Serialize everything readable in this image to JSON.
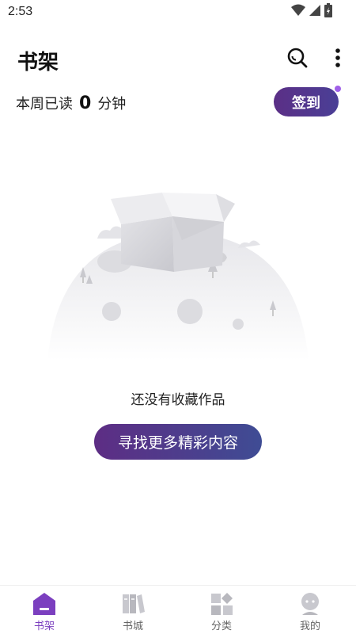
{
  "status_bar": {
    "time": "2:53"
  },
  "header": {
    "title": "书架"
  },
  "reading": {
    "prefix": "本周已读",
    "minutes": "0",
    "suffix": "分钟"
  },
  "checkin": {
    "label": "签到"
  },
  "empty_state": {
    "message": "还没有收藏作品",
    "action_label": "寻找更多精彩内容"
  },
  "tabs": [
    {
      "label": "书架",
      "icon": "home-shelf-icon",
      "active": true
    },
    {
      "label": "书城",
      "icon": "books-icon",
      "active": false
    },
    {
      "label": "分类",
      "icon": "grid-icon",
      "active": false
    },
    {
      "label": "我的",
      "icon": "profile-icon",
      "active": false
    }
  ],
  "colors": {
    "accent": "#7b3fbf",
    "button_gradient_start": "#5d2d84",
    "button_gradient_end": "#3f4c94"
  }
}
